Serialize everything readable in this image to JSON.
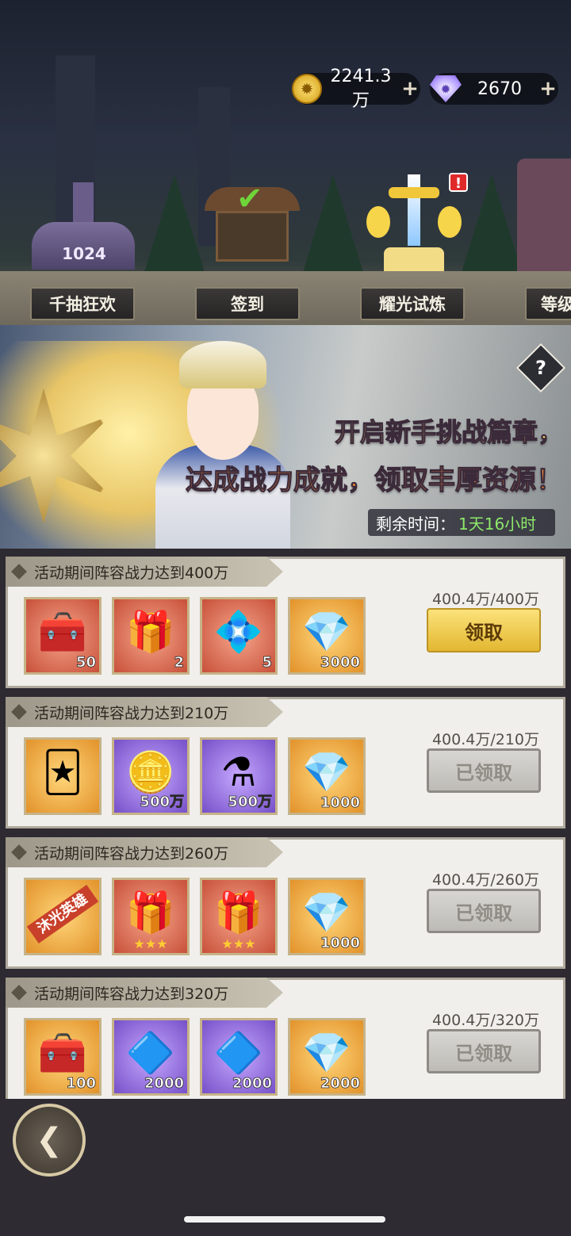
{
  "currency": {
    "gold_value": "2241.3万",
    "gem_value": "2670",
    "plus": "+"
  },
  "scene": {
    "building_1024_label": "1024",
    "alert": "!"
  },
  "nav": {
    "items": [
      "千抽狂欢",
      "签到",
      "耀光试炼",
      "等级"
    ]
  },
  "banner": {
    "help": "?",
    "slogan_line1": "开启新手挑战篇章，",
    "slogan_line2": "达成战力成就，领取丰厚资源！",
    "timer_label": "剩余时间：",
    "timer_value": "1天16小时"
  },
  "tasks": [
    {
      "title": "活动期间阵容战力达到400万",
      "progress": "400.4万/400万",
      "button": "领取",
      "items": [
        {
          "icon": "treasure-chest-icon",
          "qty": "50"
        },
        {
          "icon": "red-chest-icon",
          "qty": "2"
        },
        {
          "icon": "crystal-cube-icon",
          "qty": "5"
        },
        {
          "icon": "diamond-icon",
          "qty": "3000"
        }
      ]
    },
    {
      "title": "活动期间阵容战力达到210万",
      "progress": "400.4万/210万",
      "button": "已领取",
      "items": [
        {
          "icon": "hero-card-icon",
          "qty": ""
        },
        {
          "icon": "gold-coin-icon",
          "qty": "500万"
        },
        {
          "icon": "potion-icon",
          "qty": "500万"
        },
        {
          "icon": "diamond-icon",
          "qty": "1000"
        }
      ]
    },
    {
      "title": "活动期间阵容战力达到260万",
      "progress": "400.4万/260万",
      "button": "已领取",
      "items": [
        {
          "icon": "hero-ticket-icon",
          "qty": "",
          "ribbon": "沐光英雄"
        },
        {
          "icon": "three-star-chest-icon",
          "qty": "",
          "stars": "★★★"
        },
        {
          "icon": "three-star-chest-icon",
          "qty": "",
          "stars": "★★★"
        },
        {
          "icon": "diamond-icon",
          "qty": "1000"
        }
      ]
    },
    {
      "title": "活动期间阵容战力达到320万",
      "progress": "400.4万/320万",
      "button": "已领取",
      "items": [
        {
          "icon": "silver-chest-icon",
          "qty": "100"
        },
        {
          "icon": "blue-crystal-icon",
          "qty": "2000"
        },
        {
          "icon": "blue-crystal-icon",
          "qty": "2000"
        },
        {
          "icon": "diamond-icon",
          "qty": "2000"
        }
      ]
    }
  ]
}
